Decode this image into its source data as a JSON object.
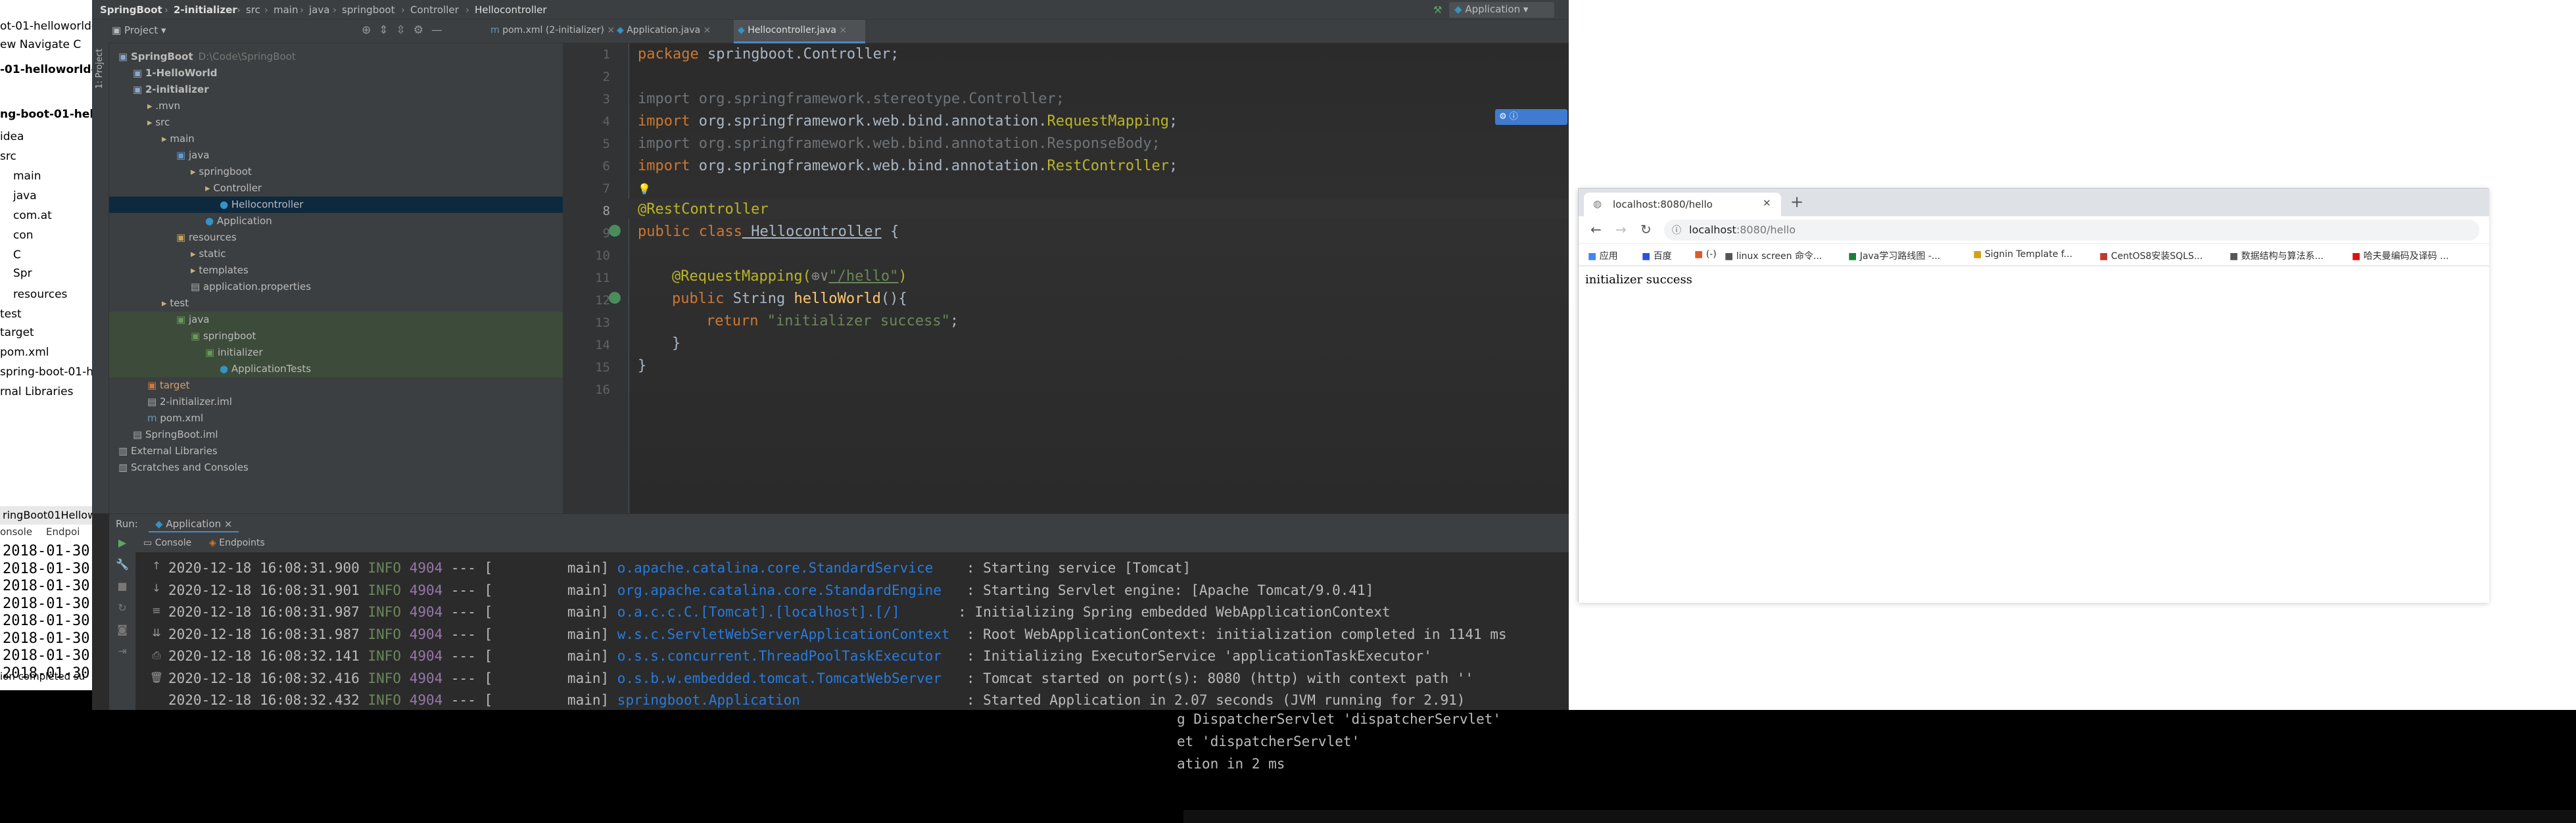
{
  "back_window": {
    "lines": [
      "ot-01-helloworld-",
      "ew  Navigate  C",
      "-01-helloworld-c",
      "ng-boot-01-hell",
      "idea",
      "src",
      "main",
      "java",
      "com.at",
      "con",
      "C",
      "Spr",
      "resources",
      "test",
      "target",
      "pom.xml",
      "spring-boot-01-h",
      "rnal Libraries"
    ],
    "console_tab": "ringBoot01Hellow",
    "console_labels": [
      "onsole",
      "Endpoi"
    ],
    "log_lines": [
      "2018-01-30",
      "2018-01-30",
      "2018-01-30",
      "2018-01-30",
      "2018-01-30",
      "2018-01-30",
      "2018-01-30",
      "2018-01-30"
    ],
    "status_text": "ion completed su",
    "status_items": [
      "al",
      "Spring"
    ]
  },
  "ide": {
    "breadcrumbs": [
      "SpringBoot",
      "2-initializer",
      "src",
      "main",
      "java",
      "springboot",
      "Controller",
      "Hellocontroller"
    ],
    "run_config": "Application",
    "project_panel_title": "Project",
    "tabs": [
      {
        "label": "pom.xml (2-initializer)",
        "active": false
      },
      {
        "label": "Application.java",
        "active": false
      },
      {
        "label": "Hellocontroller.java",
        "active": true
      }
    ],
    "tree": [
      {
        "label": "SpringBoot",
        "extra": "D:\\Code\\SpringBoot",
        "indent": 0,
        "kind": "module"
      },
      {
        "label": "1-HelloWorld",
        "indent": 1,
        "kind": "module"
      },
      {
        "label": "2-initializer",
        "indent": 1,
        "kind": "module"
      },
      {
        "label": ".mvn",
        "indent": 2,
        "kind": "folder"
      },
      {
        "label": "src",
        "indent": 2,
        "kind": "folder"
      },
      {
        "label": "main",
        "indent": 3,
        "kind": "folder"
      },
      {
        "label": "java",
        "indent": 4,
        "kind": "src"
      },
      {
        "label": "springboot",
        "indent": 5,
        "kind": "folder"
      },
      {
        "label": "Controller",
        "indent": 6,
        "kind": "folder"
      },
      {
        "label": "Hellocontroller",
        "indent": 7,
        "kind": "class",
        "selected": true
      },
      {
        "label": "Application",
        "indent": 6,
        "kind": "class"
      },
      {
        "label": "resources",
        "indent": 4,
        "kind": "res"
      },
      {
        "label": "static",
        "indent": 5,
        "kind": "folder"
      },
      {
        "label": "templates",
        "indent": 5,
        "kind": "folder"
      },
      {
        "label": "application.properties",
        "indent": 5,
        "kind": "file"
      },
      {
        "label": "test",
        "indent": 3,
        "kind": "folder"
      },
      {
        "label": "java",
        "indent": 4,
        "kind": "test"
      },
      {
        "label": "springboot",
        "indent": 5,
        "kind": "test"
      },
      {
        "label": "initializer",
        "indent": 6,
        "kind": "test"
      },
      {
        "label": "ApplicationTests",
        "indent": 7,
        "kind": "class-test"
      },
      {
        "label": "target",
        "indent": 2,
        "kind": "target"
      },
      {
        "label": "2-initializer.iml",
        "indent": 2,
        "kind": "file"
      },
      {
        "label": "pom.xml",
        "indent": 2,
        "kind": "maven"
      },
      {
        "label": "SpringBoot.iml",
        "indent": 1,
        "kind": "file"
      },
      {
        "label": "External Libraries",
        "indent": 0,
        "kind": "lib"
      },
      {
        "label": "Scratches and Consoles",
        "indent": 0,
        "kind": "lib"
      }
    ],
    "line_numbers": [
      "1",
      "2",
      "3",
      "4",
      "5",
      "6",
      "7",
      "8",
      "9",
      "10",
      "11",
      "12",
      "13",
      "14",
      "15",
      "16"
    ],
    "code": {
      "l1_kw": "package",
      "l1_rest": " springboot.Controller;",
      "l3": "import org.springframework.stereotype.Controller;",
      "l4_kw": "import",
      "l4_mid": " org.springframework.web.bind.annotation.",
      "l4_cls": "RequestMapping",
      "l4_end": ";",
      "l5": "import org.springframework.web.bind.annotation.ResponseBody;",
      "l6_kw": "import",
      "l6_mid": " org.springframework.web.bind.annotation.",
      "l6_cls": "RestController",
      "l6_end": ";",
      "l8": "@RestController",
      "l9_kw": "public class",
      "l9_name": " Hellocontroller",
      "l9_end": " {",
      "l11_ann": "@RequestMapping(",
      "l11_str": "\"/hello\"",
      "l11_end": ")",
      "l12_kw": "public",
      "l12_mid": " String ",
      "l12_fn": "helloWorld",
      "l12_end": "(){",
      "l13_kw": "return",
      "l13_str": " \"initializer success\"",
      "l13_end": ";",
      "l14": "}",
      "l15": "}"
    },
    "run": {
      "label": "Run:",
      "tab": "Application",
      "subtabs": [
        "Console",
        "Endpoints"
      ],
      "logs": [
        {
          "ts": "2020-12-18 16:08:31.900",
          "level": "INFO",
          "pid": "4904",
          "thread": "main",
          "logger": "o.apache.catalina.core.StandardService   ",
          "msg": "Starting service [Tomcat]"
        },
        {
          "ts": "2020-12-18 16:08:31.901",
          "level": "INFO",
          "pid": "4904",
          "thread": "main",
          "logger": "org.apache.catalina.core.StandardEngine  ",
          "msg": "Starting Servlet engine: [Apache Tomcat/9.0.41]"
        },
        {
          "ts": "2020-12-18 16:08:31.987",
          "level": "INFO",
          "pid": "4904",
          "thread": "main",
          "logger": "o.a.c.c.C.[Tomcat].[localhost].[/]      ",
          "msg": "Initializing Spring embedded WebApplicationContext"
        },
        {
          "ts": "2020-12-18 16:08:31.987",
          "level": "INFO",
          "pid": "4904",
          "thread": "main",
          "logger": "w.s.c.ServletWebServerApplicationContext ",
          "msg": "Root WebApplicationContext: initialization completed in 1141 ms"
        },
        {
          "ts": "2020-12-18 16:08:32.141",
          "level": "INFO",
          "pid": "4904",
          "thread": "main",
          "logger": "o.s.s.concurrent.ThreadPoolTaskExecutor  ",
          "msg": "Initializing ExecutorService 'applicationTaskExecutor'"
        },
        {
          "ts": "2020-12-18 16:08:32.416",
          "level": "INFO",
          "pid": "4904",
          "thread": "main",
          "logger": "o.s.b.w.embedded.tomcat.TomcatWebServer  ",
          "msg": "Tomcat started on port(s): 8080 (http) with context path ''"
        },
        {
          "ts": "2020-12-18 16:08:32.432",
          "level": "INFO",
          "pid": "4904",
          "thread": "main",
          "logger": "springboot.Application                   ",
          "msg": "Started Application in 2.07 seconds (JVM running for 2.91)"
        }
      ],
      "overflow": [
        "g DispatcherServlet 'dispatcherServlet'",
        "et 'dispatcherServlet'",
        "ation in 2 ms"
      ]
    }
  },
  "browser": {
    "tab_title": "localhost:8080/hello",
    "url_host": "localhost",
    "url_path": ":8080/hello",
    "bookmarks": [
      "应用",
      "百度",
      "(-)",
      "linux screen 命令...",
      "Java学习路线图 -...",
      "Signin Template f...",
      "CentOS8安装SQLS...",
      "数据结构与算法系...",
      "哈夫曼编码及译码 ..."
    ],
    "page_text": "initializer success"
  }
}
